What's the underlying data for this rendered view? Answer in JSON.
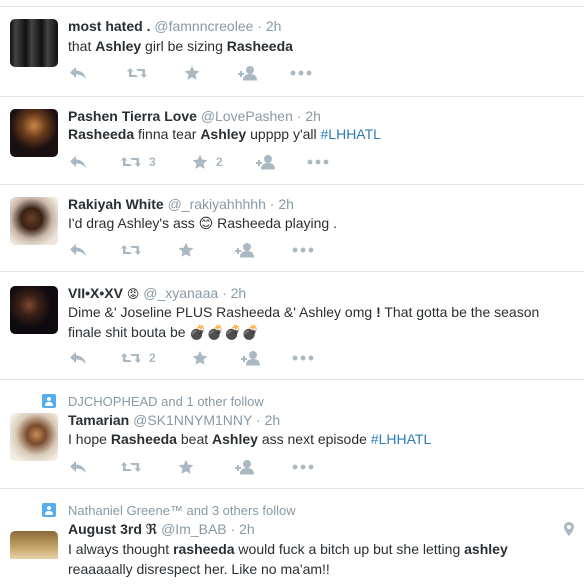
{
  "tweets": [
    {
      "name": "most hated .",
      "handle": "@famnncreolee",
      "sep": "·",
      "time": "2h",
      "text": {
        "p1": "that ",
        "b1": "Ashley",
        "p2": " girl be sizing ",
        "b2": "Rasheeda"
      },
      "retweets": "",
      "favorites": ""
    },
    {
      "name": "Pashen Tierra Love",
      "handle": "@LovePashen",
      "sep": "·",
      "time": "2h",
      "text": {
        "b1": "Rasheeda",
        "p1": " finna tear ",
        "b2": "Ashley",
        "p2": " upppp y'all ",
        "hashtag": "#LHHATL"
      },
      "retweets": "3",
      "favorites": "2"
    },
    {
      "name": "Rakiyah White",
      "handle": "@_rakiyahhhhh",
      "sep": "·",
      "time": "2h",
      "text": {
        "p1": "I'd drag Ashley's ass ",
        "emoji": "😊",
        "p2": " Rasheeda playing ."
      },
      "retweets": "",
      "favorites": ""
    },
    {
      "name": "VII•X•XV",
      "name_badge": "😡",
      "handle": "@_xyanaaa",
      "sep": "·",
      "time": "2h",
      "text": {
        "p1": "Dime &' Joseline PLUS Rasheeda &' Ashley omg ",
        "b1": "!",
        "p2": " That gotta be the season finale shit bouta be ",
        "emoji": "💣💣💣💣"
      },
      "retweets": "2",
      "favorites": ""
    },
    {
      "social": "DJCHOPHEAD and 1 other follow",
      "name": "Tamarian",
      "handle": "@SK1NNYM1NNY",
      "sep": "·",
      "time": "2h",
      "text": {
        "p1": "I hope ",
        "b1": "Rasheeda",
        "p2": " beat ",
        "b2": "Ashley",
        "p3": " ass next episode ",
        "hashtag": "#LHHATL"
      },
      "retweets": "",
      "favorites": ""
    },
    {
      "social": "Nathaniel Greene™ and 3 others follow",
      "name": "August 3rd",
      "name_badge": "ℜ",
      "handle": "@Im_BAB",
      "sep": "·",
      "time": "2h",
      "text": {
        "p1": "I always thought ",
        "b1": "rasheeda",
        "p2": " would fuck a bitch up but she letting ",
        "b2": "ashley",
        "p3": " reaaaaally disrespect her. Like no ma'am!!"
      },
      "retweets": "",
      "favorites": ""
    }
  ],
  "colors": {
    "accent": "#2b7bb9",
    "muted": "#8899a6",
    "icon": "#aab8c2",
    "social_icon": "#55acee"
  },
  "icons": [
    "reply-icon",
    "retweet-icon",
    "favorite-icon",
    "follow-icon",
    "more-icon",
    "location-icon",
    "follow-badge-icon"
  ]
}
